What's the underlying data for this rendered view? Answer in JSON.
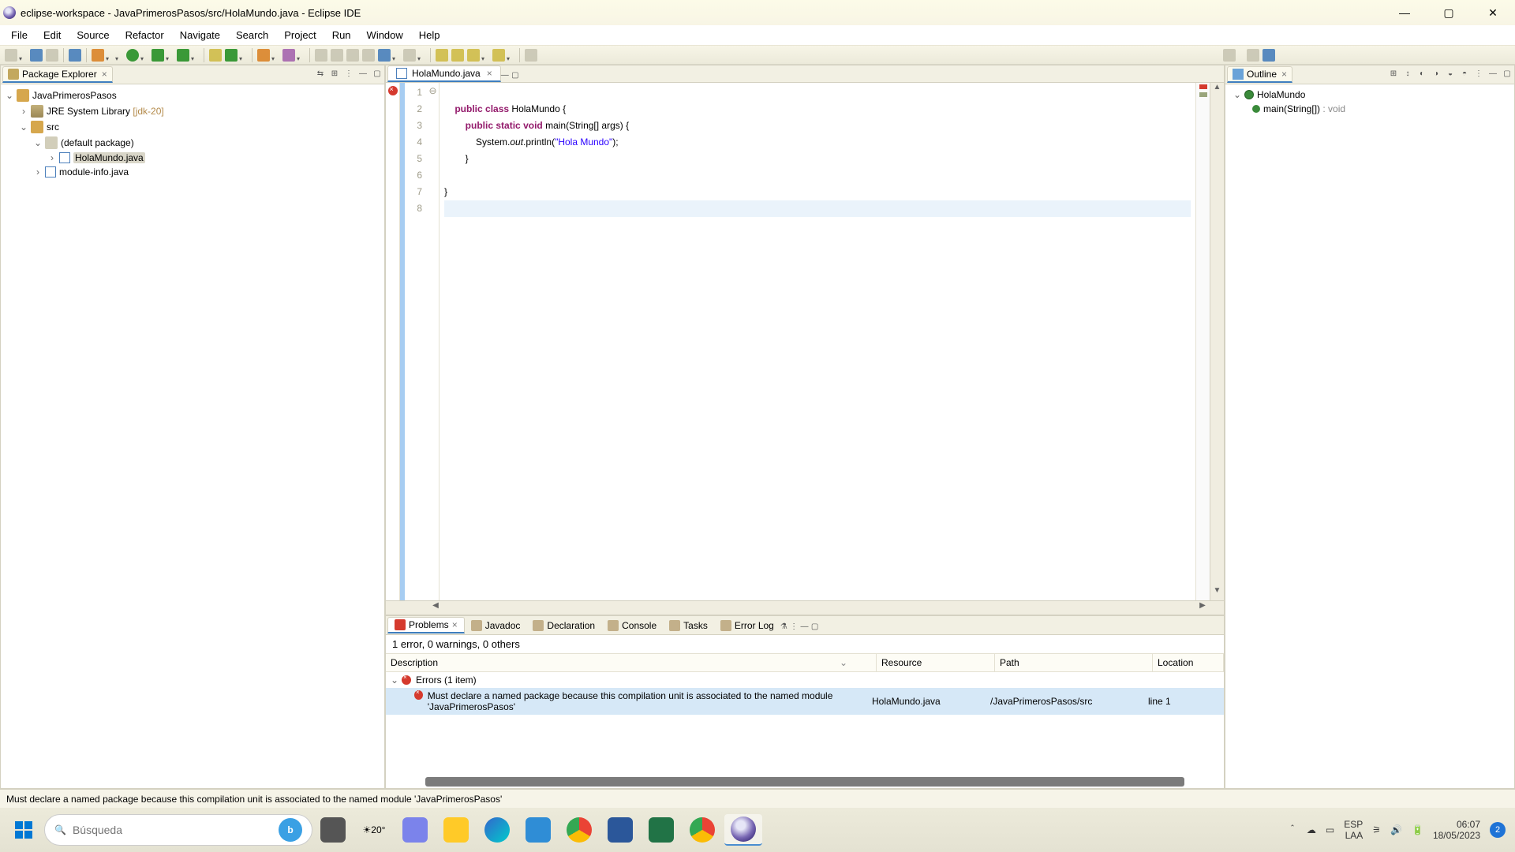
{
  "window": {
    "title": "eclipse-workspace - JavaPrimerosPasos/src/HolaMundo.java - Eclipse IDE"
  },
  "menu": [
    "File",
    "Edit",
    "Source",
    "Refactor",
    "Navigate",
    "Search",
    "Project",
    "Run",
    "Window",
    "Help"
  ],
  "package_explorer": {
    "title": "Package Explorer",
    "project": "JavaPrimerosPasos",
    "jre": "JRE System Library",
    "jre_ver": "[jdk-20]",
    "src": "src",
    "pkg": "(default package)",
    "file1": "HolaMundo.java",
    "file2": "module-info.java"
  },
  "editor": {
    "tab": "HolaMundo.java",
    "lines": [
      "1",
      "2",
      "3",
      "4",
      "5",
      "6",
      "7",
      "8"
    ],
    "fold": [
      "",
      "",
      "⊖",
      "",
      "",
      "",
      "",
      ""
    ],
    "c1_kw1": "public",
    "c1_kw2": "class",
    "c1_cls": "HolaMundo",
    "c1_br": "{",
    "c2_kw1": "public",
    "c2_kw2": "static",
    "c2_kw3": "void",
    "c2_m": "main(String[] args) {",
    "c3_a": "System.",
    "c3_out": "out",
    "c3_b": ".println(",
    "c3_str": "\"Hola Mundo\"",
    "c3_c": ");",
    "c4": "}",
    "c6": "}"
  },
  "outline": {
    "title": "Outline",
    "class": "HolaMundo",
    "method": "main(String[])",
    "rtype": ": void"
  },
  "problems": {
    "tabs": [
      "Problems",
      "Javadoc",
      "Declaration",
      "Console",
      "Tasks",
      "Error Log"
    ],
    "summary": "1 error, 0 warnings, 0 others",
    "cols": {
      "desc": "Description",
      "res": "Resource",
      "path": "Path",
      "loc": "Location"
    },
    "group": "Errors (1 item)",
    "err_desc": "Must declare a named package because this compilation unit is associated to the named module 'JavaPrimerosPasos'",
    "err_res": "HolaMundo.java",
    "err_path": "/JavaPrimerosPasos/src",
    "err_loc": "line 1"
  },
  "status": "Must declare a named package because this compilation unit is associated to the named module 'JavaPrimerosPasos'",
  "taskbar": {
    "search_ph": "Búsqueda",
    "weather": "20°",
    "lang1": "ESP",
    "lang2": "LAA",
    "time": "06:07",
    "date": "18/05/2023",
    "notif": "2"
  }
}
